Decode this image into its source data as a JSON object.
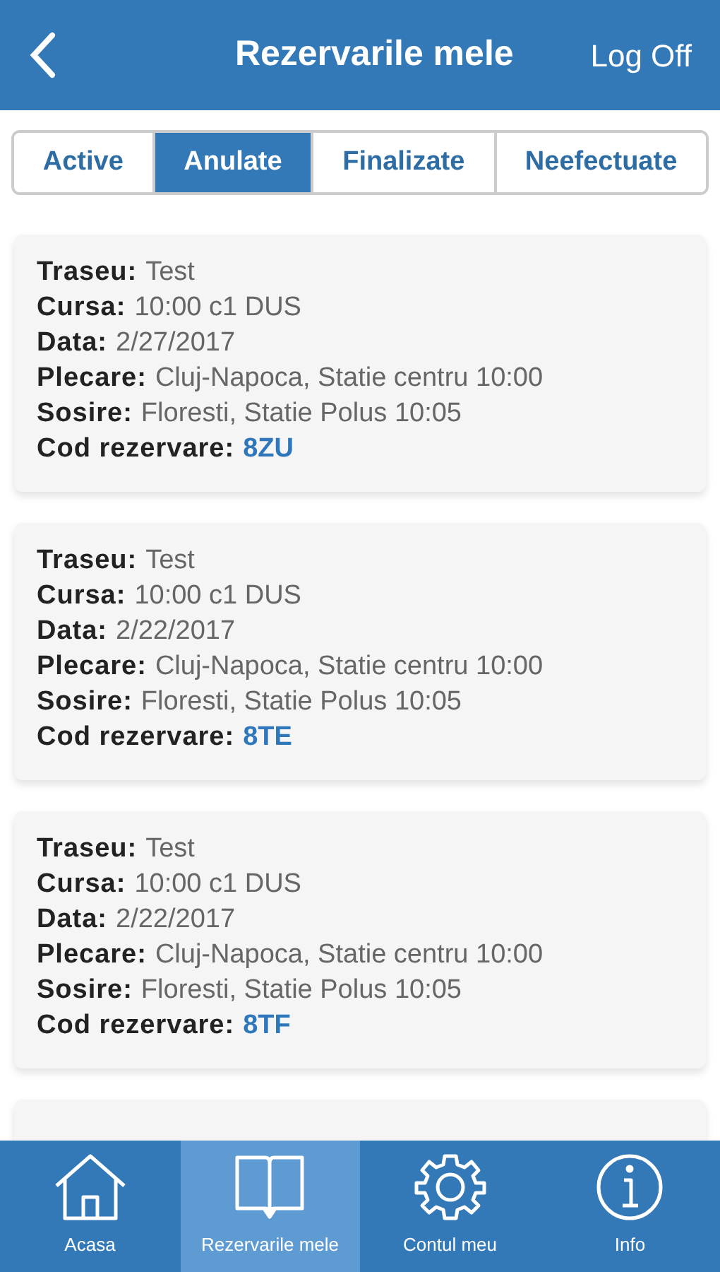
{
  "header": {
    "title": "Rezervarile mele",
    "action": "Log Off"
  },
  "tabs": [
    {
      "label": "Active",
      "selected": false
    },
    {
      "label": "Anulate",
      "selected": true
    },
    {
      "label": "Finalizate",
      "selected": false
    },
    {
      "label": "Neefectuate",
      "selected": false
    }
  ],
  "reservations": [
    {
      "fields": [
        {
          "label": "Traseu:",
          "value": "Test",
          "kind": "text"
        },
        {
          "label": "Cursa:",
          "value": "10:00 c1 DUS",
          "kind": "text"
        },
        {
          "label": "Data:",
          "value": "2/27/2017",
          "kind": "text"
        },
        {
          "label": "Plecare:",
          "value": "Cluj-Napoca, Statie centru 10:00",
          "kind": "text"
        },
        {
          "label": "Sosire:",
          "value": "Floresti, Statie Polus 10:05",
          "kind": "text"
        },
        {
          "label": "Cod rezervare:",
          "value": "8ZU",
          "kind": "code"
        }
      ]
    },
    {
      "fields": [
        {
          "label": "Traseu:",
          "value": "Test",
          "kind": "text"
        },
        {
          "label": "Cursa:",
          "value": "10:00 c1 DUS",
          "kind": "text"
        },
        {
          "label": "Data:",
          "value": "2/22/2017",
          "kind": "text"
        },
        {
          "label": "Plecare:",
          "value": "Cluj-Napoca, Statie centru 10:00",
          "kind": "text"
        },
        {
          "label": "Sosire:",
          "value": "Floresti, Statie Polus 10:05",
          "kind": "text"
        },
        {
          "label": "Cod rezervare:",
          "value": "8TE",
          "kind": "code"
        }
      ]
    },
    {
      "fields": [
        {
          "label": "Traseu:",
          "value": "Test",
          "kind": "text"
        },
        {
          "label": "Cursa:",
          "value": "10:00 c1 DUS",
          "kind": "text"
        },
        {
          "label": "Data:",
          "value": "2/22/2017",
          "kind": "text"
        },
        {
          "label": "Plecare:",
          "value": "Cluj-Napoca, Statie centru 10:00",
          "kind": "text"
        },
        {
          "label": "Sosire:",
          "value": "Floresti, Statie Polus 10:05",
          "kind": "text"
        },
        {
          "label": "Cod rezervare:",
          "value": "8TF",
          "kind": "code"
        }
      ]
    }
  ],
  "nav": [
    {
      "label": "Acasa",
      "kind": "home",
      "selected": false
    },
    {
      "label": "Rezervarile mele",
      "kind": "book",
      "selected": true
    },
    {
      "label": "Contul meu",
      "kind": "gear",
      "selected": false
    },
    {
      "label": "Info",
      "kind": "info",
      "selected": false
    }
  ]
}
